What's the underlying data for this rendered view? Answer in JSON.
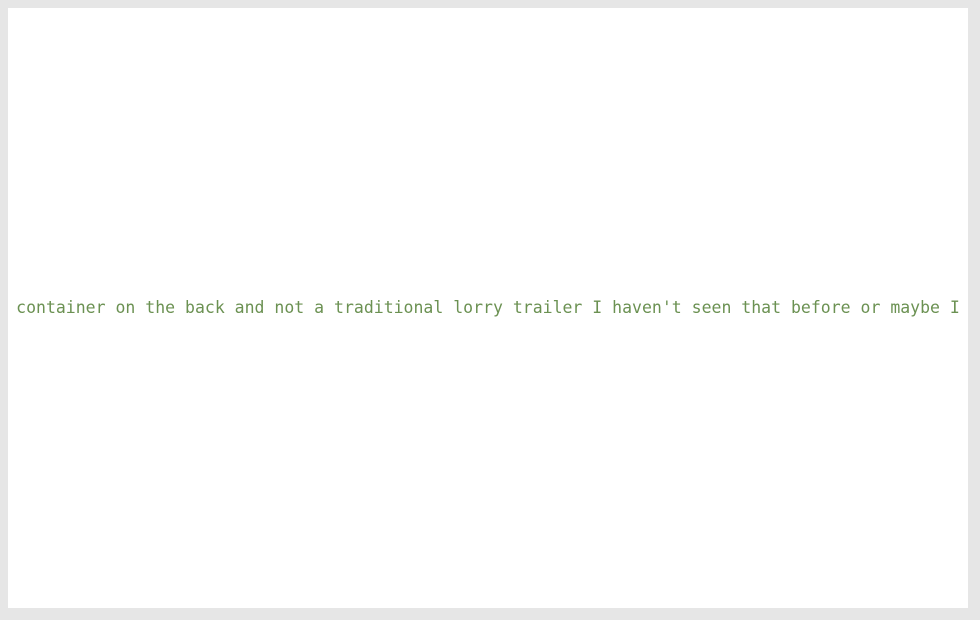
{
  "caption": {
    "text": "container on the back and not a traditional lorry trailer I haven't seen that before or maybe I"
  },
  "colors": {
    "background_frame": "#e6e6e6",
    "canvas": "#ffffff",
    "caption_text": "#6b9152"
  }
}
